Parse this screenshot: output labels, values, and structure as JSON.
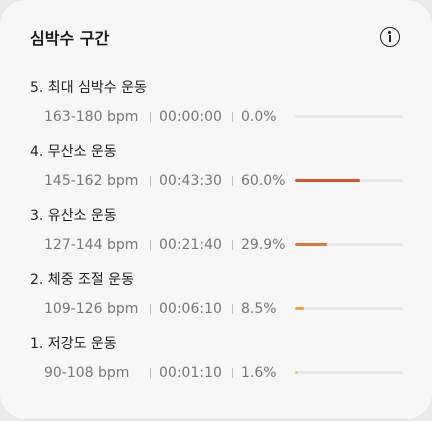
{
  "card": {
    "title": "심박수 구간"
  },
  "zones": [
    {
      "name": "5. 최대 심박수 운동",
      "bpm": "163-180 bpm",
      "time": "00:00:00",
      "percent": "0.0%",
      "fraction": 0.0,
      "color": "#d7542e"
    },
    {
      "name": "4. 무산소 운동",
      "bpm": "145-162 bpm",
      "time": "00:43:30",
      "percent": "60.0%",
      "fraction": 0.6,
      "color": "#d7542e"
    },
    {
      "name": "3. 유산소 운동",
      "bpm": "127-144 bpm",
      "time": "00:21:40",
      "percent": "29.9%",
      "fraction": 0.299,
      "color": "#e0783a"
    },
    {
      "name": "2. 체중 조절 운동",
      "bpm": "109-126 bpm",
      "time": "00:06:10",
      "percent": "8.5%",
      "fraction": 0.085,
      "color": "#eea236"
    },
    {
      "name": "1. 저강도 운동",
      "bpm": "90-108 bpm",
      "time": "00:01:10",
      "percent": "1.6%",
      "fraction": 0.016,
      "color": "#f1d24a"
    }
  ]
}
